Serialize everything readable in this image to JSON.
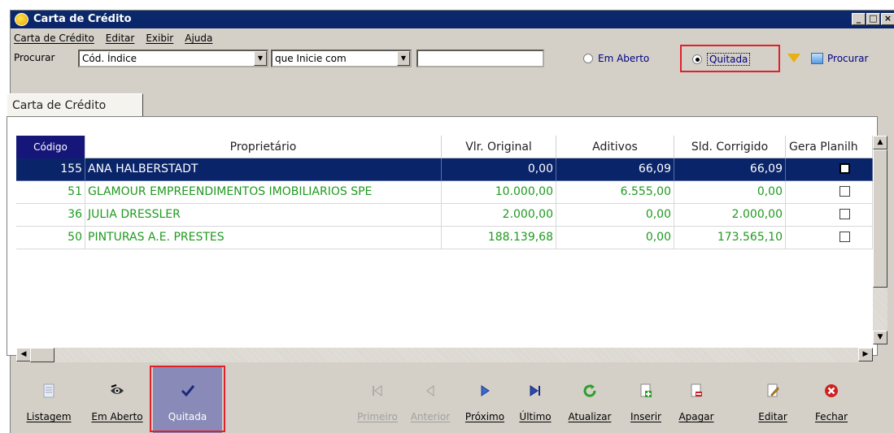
{
  "window": {
    "title": "Carta de Crédito"
  },
  "menu": [
    "Carta de Crédito",
    "Editar",
    "Exibir",
    "Ajuda"
  ],
  "search": {
    "label": "Procurar",
    "field": "Cód. Índice",
    "condition": "que Inicie com",
    "value": "",
    "radio_open": "Em Aberto",
    "radio_paid": "Quitada",
    "selected": "Quitada",
    "search_button": "Procurar"
  },
  "tab": "Carta de Crédito",
  "table": {
    "columns": [
      "Código",
      "Proprietário",
      "Vlr. Original",
      "Aditivos",
      "Sld. Corrigido",
      "Gera Planilh"
    ],
    "rows": [
      {
        "codigo": "155",
        "proprietario": "ANA HALBERSTADT",
        "vlr_original": "0,00",
        "aditivos": "66,09",
        "sld_corrigido": "66,09",
        "gera_planilha": false,
        "selected": true
      },
      {
        "codigo": "51",
        "proprietario": "GLAMOUR EMPREENDIMENTOS IMOBILIARIOS SPE",
        "vlr_original": "10.000,00",
        "aditivos": "6.555,00",
        "sld_corrigido": "0,00",
        "gera_planilha": false,
        "selected": false
      },
      {
        "codigo": "36",
        "proprietario": "JULIA DRESSLER",
        "vlr_original": "2.000,00",
        "aditivos": "0,00",
        "sld_corrigido": "2.000,00",
        "gera_planilha": false,
        "selected": false
      },
      {
        "codigo": "50",
        "proprietario": "PINTURAS A.E. PRESTES",
        "vlr_original": "188.139,68",
        "aditivos": "0,00",
        "sld_corrigido": "173.565,10",
        "gera_planilha": false,
        "selected": false
      }
    ]
  },
  "toolbar": {
    "listagem": "Listagem",
    "em_aberto": "Em Aberto",
    "quitada": "Quitada",
    "primeiro": "Primeiro",
    "anterior": "Anterior",
    "proximo": "Próximo",
    "ultimo": "Último",
    "atualizar": "Atualizar",
    "inserir": "Inserir",
    "apagar": "Apagar",
    "editar": "Editar",
    "fechar": "Fechar"
  },
  "colors": {
    "title_bar": "#0a246a",
    "row_text": "#1f9a1f",
    "selected_row": "#0a246a",
    "highlight": "#e0202a",
    "active_button": "#8a8ab8"
  },
  "icons": [
    "app-icon",
    "filter-icon",
    "search-icon",
    "list-icon",
    "eye-icon",
    "check-icon",
    "first-icon",
    "previous-icon",
    "next-icon",
    "last-icon",
    "refresh-icon",
    "insert-icon",
    "delete-icon",
    "edit-icon",
    "close-icon"
  ]
}
